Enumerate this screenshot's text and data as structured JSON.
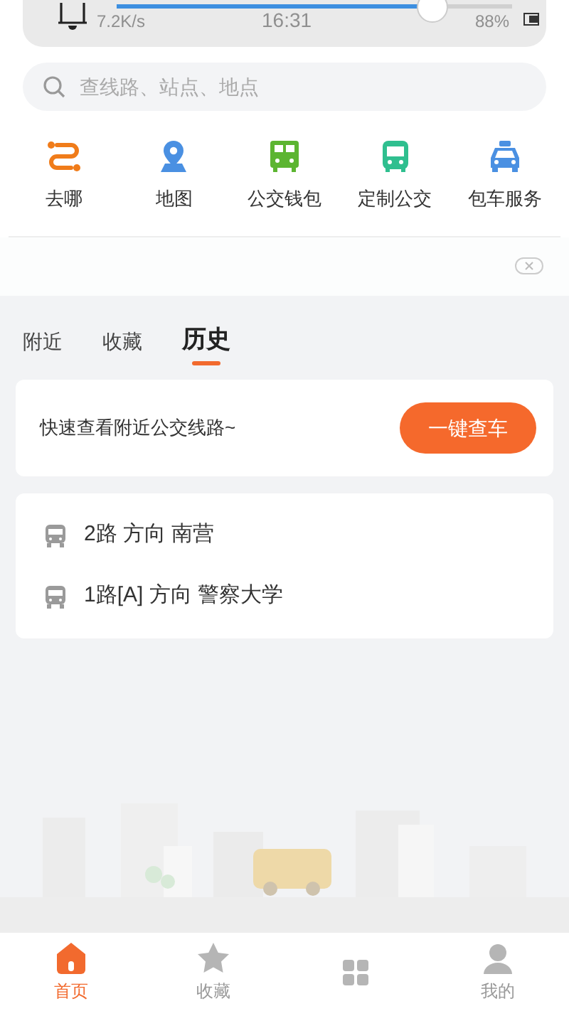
{
  "status_bar": {
    "speed": "7.2K/s",
    "time": "16:31",
    "battery": "88%"
  },
  "volume": {
    "level": 0.8
  },
  "search": {
    "placeholder": "查线路、站点、地点"
  },
  "shortcuts": [
    {
      "kind": "route",
      "label": "去哪"
    },
    {
      "kind": "map",
      "label": "地图"
    },
    {
      "kind": "wallet",
      "label": "公交钱包"
    },
    {
      "kind": "bus",
      "label": "定制公交"
    },
    {
      "kind": "taxi",
      "label": "包车服务"
    }
  ],
  "tabs": [
    {
      "label": "附近",
      "selected": false
    },
    {
      "label": "收藏",
      "selected": false
    },
    {
      "label": "历史",
      "selected": true
    }
  ],
  "quick_card": {
    "text": "快速查看附近公交线路~",
    "button": "一键查车"
  },
  "history": [
    {
      "route": "2路 方向 南营"
    },
    {
      "route": "1路[A] 方向 警察大学"
    }
  ],
  "nav": [
    {
      "kind": "home",
      "label": "首页",
      "selected": true
    },
    {
      "kind": "star",
      "label": "收藏",
      "selected": false
    },
    {
      "kind": "other",
      "selected": false
    },
    {
      "kind": "user",
      "label": "我的",
      "selected": false
    }
  ]
}
